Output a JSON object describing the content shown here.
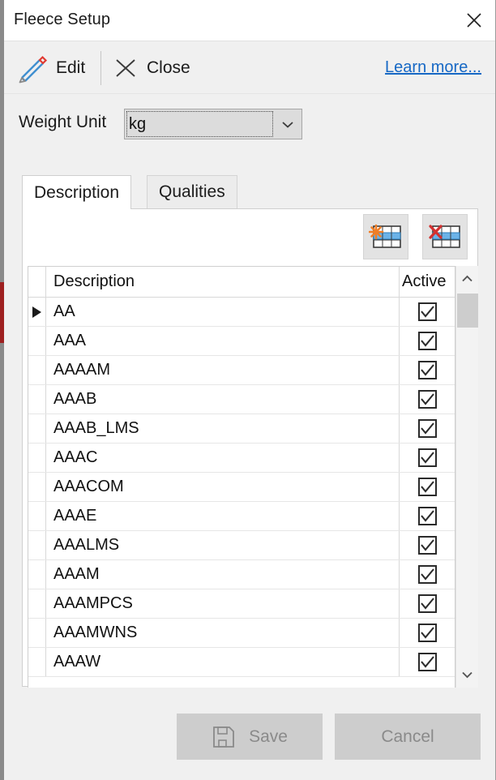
{
  "window": {
    "title": "Fleece Setup",
    "close_icon": "close-icon"
  },
  "commandbar": {
    "edit_label": "Edit",
    "edit_icon": "pencil-icon",
    "close_label": "Close",
    "close_icon": "x-icon",
    "learn_more_label": "Learn more..."
  },
  "weight_unit": {
    "label": "Weight Unit",
    "value": "kg",
    "dropdown_icon": "chevron-down-icon"
  },
  "tabs": [
    {
      "label": "Description",
      "active": true
    },
    {
      "label": "Qualities",
      "active": false
    }
  ],
  "grid_toolbar": {
    "add_row_icon": "add-row-icon",
    "delete_row_icon": "delete-row-icon"
  },
  "grid": {
    "columns": [
      "Description",
      "Active"
    ],
    "rows": [
      {
        "description": "AA",
        "active": true,
        "selected": true
      },
      {
        "description": "AAA",
        "active": true,
        "selected": false
      },
      {
        "description": "AAAAM",
        "active": true,
        "selected": false
      },
      {
        "description": "AAAB",
        "active": true,
        "selected": false
      },
      {
        "description": "AAAB_LMS",
        "active": true,
        "selected": false
      },
      {
        "description": "AAAC",
        "active": true,
        "selected": false
      },
      {
        "description": "AAACOM",
        "active": true,
        "selected": false
      },
      {
        "description": "AAAE",
        "active": true,
        "selected": false
      },
      {
        "description": "AAALMS",
        "active": true,
        "selected": false
      },
      {
        "description": "AAAM",
        "active": true,
        "selected": false
      },
      {
        "description": "AAAMPCS",
        "active": true,
        "selected": false
      },
      {
        "description": "AAAMWNS",
        "active": true,
        "selected": false
      },
      {
        "description": "AAAW",
        "active": true,
        "selected": false
      }
    ],
    "scrollbar": {
      "up_icon": "chevron-up-icon",
      "down_icon": "chevron-down-icon"
    }
  },
  "footer": {
    "save_label": "Save",
    "save_icon": "floppy-disk-icon",
    "save_enabled": false,
    "cancel_label": "Cancel",
    "cancel_enabled": false
  },
  "colors": {
    "link": "#1668c5",
    "accent_blue": "#4a9fe0",
    "accent_orange": "#f07e26",
    "accent_red": "#d3302f",
    "window_bg": "#f0f0f0"
  }
}
